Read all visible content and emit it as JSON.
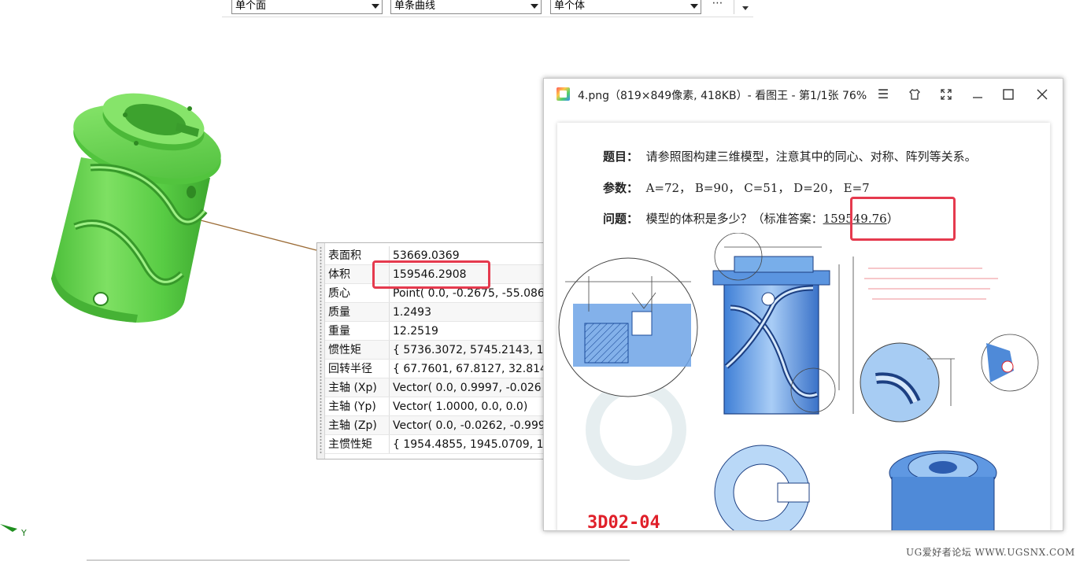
{
  "toolbar": {
    "face_filter": "单个面",
    "curve_filter": "单条曲线",
    "body_filter": "单个体",
    "more": "⋯"
  },
  "properties": {
    "rows": [
      {
        "key": "表面积",
        "value": "53669.0369"
      },
      {
        "key": "体积",
        "value": "159546.2908"
      },
      {
        "key": "质心",
        "value": "Point( 0.0, -0.2675, -55.086"
      },
      {
        "key": "质量",
        "value": "1.2493"
      },
      {
        "key": "重量",
        "value": "12.2519"
      },
      {
        "key": "惯性矩",
        "value": "{ 5736.3072, 5745.2143, 13"
      },
      {
        "key": "回转半径",
        "value": "{ 67.7601, 67.8127, 32.814"
      },
      {
        "key": "主轴 (Xp)",
        "value": "Vector( 0.0, 0.9997, -0.026"
      },
      {
        "key": "主轴 (Yp)",
        "value": "Vector( 1.0000, 0.0, 0.0)"
      },
      {
        "key": "主轴 (Zp)",
        "value": "Vector( 0.0, -0.0262, -0.999"
      },
      {
        "key": "主惯性矩",
        "value": "{ 1954.4855, 1945.0709, 13"
      }
    ]
  },
  "viewer": {
    "title": "4.png（819×849像素, 418KB）- 看图王 - 第1/1张 76%",
    "doc": {
      "title_label": "题目：",
      "title_text": "请参照图构建三维模型，注意其中的同心、对称、阵列等关系。",
      "params_label": "参数：",
      "params_text": "A=72，  B=90，  C=51，  D=20，  E=7",
      "question_label": "问题：",
      "question_text": "模型的体积是多少？（标准答案：",
      "answer": "159549.76",
      "question_end": "）",
      "model_code": "3D02-04"
    }
  },
  "axis": {
    "label": "Y"
  },
  "watermark": "UG爱好者论坛 WWW.UGSNX.COM",
  "colors": {
    "model_green": "#5fd24a",
    "highlight_red": "#e53a4e",
    "part_blue": "#6fa8e8"
  }
}
